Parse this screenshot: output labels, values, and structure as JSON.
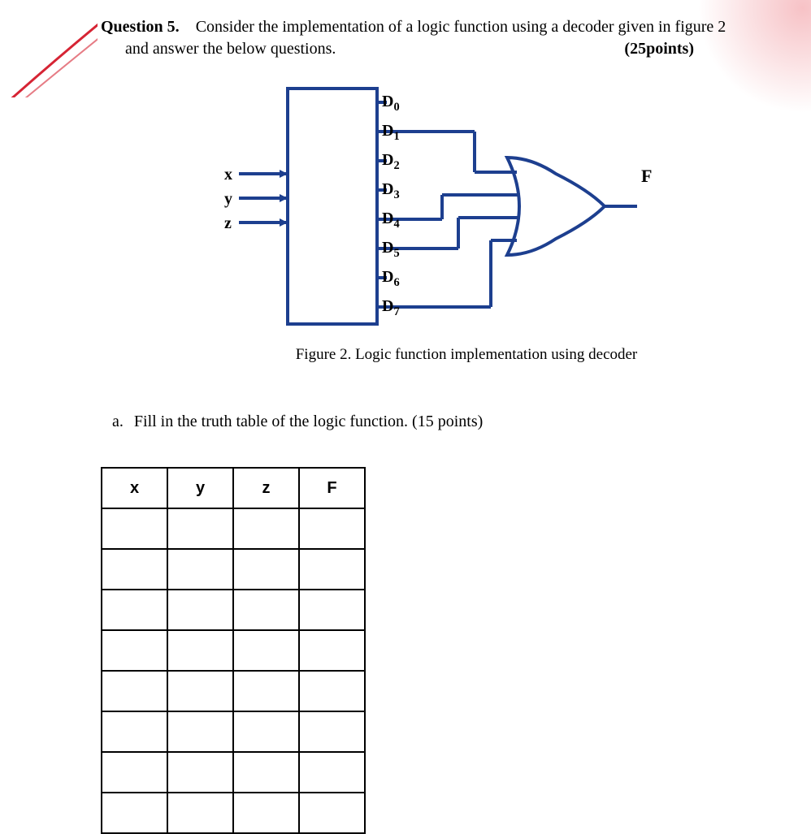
{
  "question": {
    "number_label": "Question 5.",
    "prompt_line1_rest": "Consider the implementation of a logic function using a decoder given in figure 2",
    "prompt_line2": "and answer the below questions.",
    "points": "(25points)"
  },
  "figure": {
    "inputs": [
      "x",
      "y",
      "z"
    ],
    "outputs": [
      "D",
      "D",
      "D",
      "D",
      "D",
      "D",
      "D",
      "D"
    ],
    "outputs_sub": [
      "0",
      "1",
      "2",
      "3",
      "4",
      "5",
      "6",
      "7"
    ],
    "gate_output_label": "F",
    "caption": "Figure 2. Logic function implementation using decoder"
  },
  "part_a": {
    "label": "a.",
    "text": "Fill in the truth table of the logic function. (15 points)"
  },
  "truth_table": {
    "headers": [
      "x",
      "y",
      "z",
      "F"
    ],
    "rows": 8
  },
  "colors": {
    "diagram_stroke": "#1d3f8f",
    "diagram_stroke_alt": "#16316f",
    "arc_stroke": "#d62434"
  }
}
